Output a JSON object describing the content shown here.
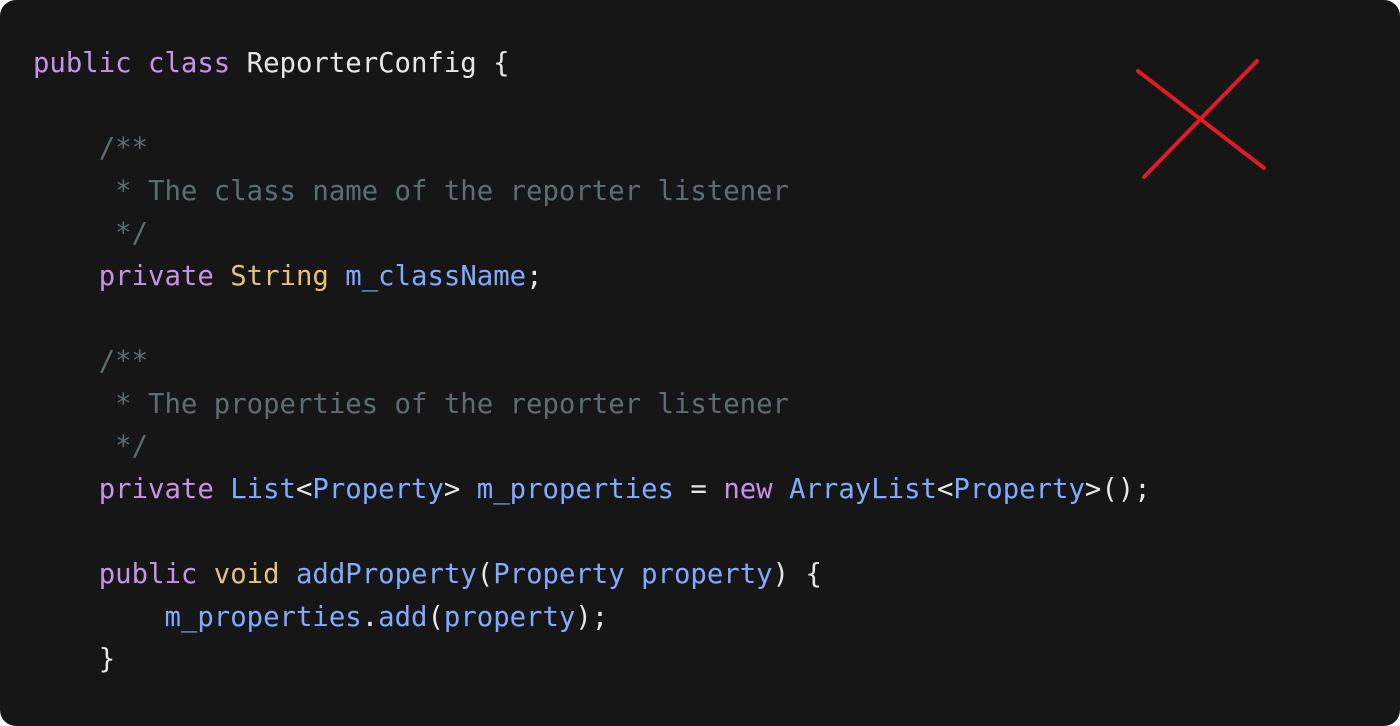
{
  "colors": {
    "background": "#161616",
    "keyword": "#c792ea",
    "type": "#e5c07b",
    "identifier": "#82aaff",
    "comment": "#5c6e74",
    "plain": "#e6e6e6",
    "x_mark": "#e01b24"
  },
  "x_mark_icon": "close-icon",
  "code": {
    "lines": [
      [
        {
          "t": "public",
          "c": "keyword"
        },
        {
          "t": " ",
          "c": "plain"
        },
        {
          "t": "class",
          "c": "keyword"
        },
        {
          "t": " ReporterConfig {",
          "c": "plain"
        }
      ],
      [],
      [
        {
          "t": "    /**",
          "c": "comment"
        }
      ],
      [
        {
          "t": "     * The class name of the reporter listener",
          "c": "comment"
        }
      ],
      [
        {
          "t": "     */",
          "c": "comment"
        }
      ],
      [
        {
          "t": "    ",
          "c": "plain"
        },
        {
          "t": "private",
          "c": "keyword"
        },
        {
          "t": " ",
          "c": "plain"
        },
        {
          "t": "String",
          "c": "type"
        },
        {
          "t": " ",
          "c": "plain"
        },
        {
          "t": "m_className",
          "c": "identifier"
        },
        {
          "t": ";",
          "c": "plain"
        }
      ],
      [],
      [
        {
          "t": "    /**",
          "c": "comment"
        }
      ],
      [
        {
          "t": "     * The properties of the reporter listener",
          "c": "comment"
        }
      ],
      [
        {
          "t": "     */",
          "c": "comment"
        }
      ],
      [
        {
          "t": "    ",
          "c": "plain"
        },
        {
          "t": "private",
          "c": "keyword"
        },
        {
          "t": " ",
          "c": "plain"
        },
        {
          "t": "List",
          "c": "identifier"
        },
        {
          "t": "<",
          "c": "plain"
        },
        {
          "t": "Property",
          "c": "identifier"
        },
        {
          "t": "> ",
          "c": "plain"
        },
        {
          "t": "m_properties",
          "c": "identifier"
        },
        {
          "t": " = ",
          "c": "plain"
        },
        {
          "t": "new",
          "c": "keyword"
        },
        {
          "t": " ",
          "c": "plain"
        },
        {
          "t": "ArrayList",
          "c": "identifier"
        },
        {
          "t": "<",
          "c": "plain"
        },
        {
          "t": "Property",
          "c": "identifier"
        },
        {
          "t": ">();",
          "c": "plain"
        }
      ],
      [],
      [
        {
          "t": "    ",
          "c": "plain"
        },
        {
          "t": "public",
          "c": "keyword"
        },
        {
          "t": " ",
          "c": "plain"
        },
        {
          "t": "void",
          "c": "type"
        },
        {
          "t": " ",
          "c": "plain"
        },
        {
          "t": "addProperty",
          "c": "identifier"
        },
        {
          "t": "(",
          "c": "plain"
        },
        {
          "t": "Property",
          "c": "identifier"
        },
        {
          "t": " ",
          "c": "plain"
        },
        {
          "t": "property",
          "c": "identifier"
        },
        {
          "t": ") {",
          "c": "plain"
        }
      ],
      [
        {
          "t": "        ",
          "c": "plain"
        },
        {
          "t": "m_properties",
          "c": "identifier"
        },
        {
          "t": ".",
          "c": "plain"
        },
        {
          "t": "add",
          "c": "identifier"
        },
        {
          "t": "(",
          "c": "plain"
        },
        {
          "t": "property",
          "c": "identifier"
        },
        {
          "t": ");",
          "c": "plain"
        }
      ],
      [
        {
          "t": "    }",
          "c": "plain"
        }
      ]
    ]
  }
}
